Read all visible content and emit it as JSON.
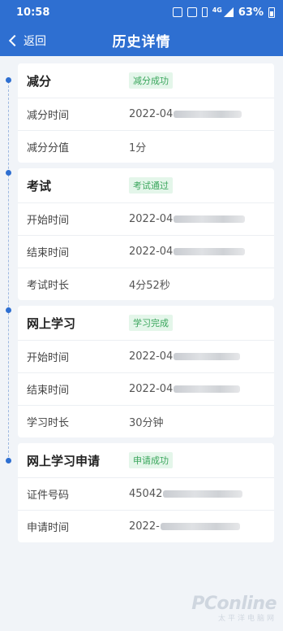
{
  "status_bar": {
    "time": "10:58",
    "network": "4G",
    "battery": "63%"
  },
  "nav": {
    "back_label": "返回",
    "title": "历史详情"
  },
  "sections": [
    {
      "title": "减分",
      "badge": "减分成功",
      "rows": [
        {
          "label": "减分时间",
          "value": "2022-04"
        },
        {
          "label": "减分分值",
          "value": "1分"
        }
      ]
    },
    {
      "title": "考试",
      "badge": "考试通过",
      "rows": [
        {
          "label": "开始时间",
          "value": "2022-04"
        },
        {
          "label": "结束时间",
          "value": "2022-04"
        },
        {
          "label": "考试时长",
          "value": "4分52秒"
        }
      ]
    },
    {
      "title": "网上学习",
      "badge": "学习完成",
      "rows": [
        {
          "label": "开始时间",
          "value": "2022-04"
        },
        {
          "label": "结束时间",
          "value": "2022-04"
        },
        {
          "label": "学习时长",
          "value": "30分钟"
        }
      ]
    },
    {
      "title": "网上学习申请",
      "badge": "申请成功",
      "rows": [
        {
          "label": "证件号码",
          "value": "45042"
        },
        {
          "label": "申请时间",
          "value": "2022-"
        }
      ]
    }
  ],
  "watermark": {
    "main": "PConline",
    "sub": "太平洋电脑网"
  },
  "colors": {
    "primary": "#2e6fd1",
    "badge_text": "#3aa65c",
    "badge_bg": "#e4f6ea",
    "background": "#f1f4f8"
  },
  "icons": [
    "nfc-icon",
    "sim-icon",
    "vibrate-icon",
    "signal-icon",
    "battery-icon",
    "chevron-left-icon"
  ]
}
